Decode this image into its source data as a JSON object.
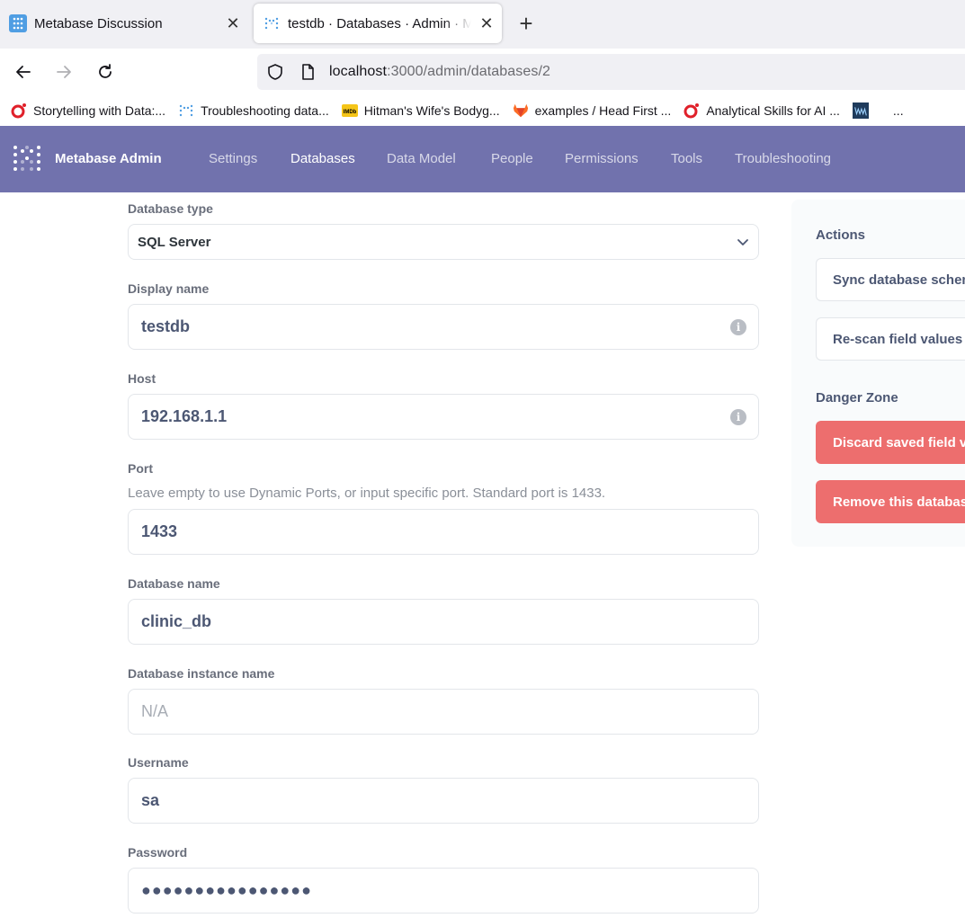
{
  "browser": {
    "tabs": [
      {
        "title": "Metabase Discussion",
        "close": "✕"
      },
      {
        "title": "testdb · Databases · Admin · Metabase",
        "close": "✕"
      }
    ],
    "new_tab": "+",
    "url_host": "localhost",
    "url_path": ":3000/admin/databases/2",
    "bookmarks": [
      {
        "label": "Storytelling with Data:...",
        "icon": "opera-icon"
      },
      {
        "label": "Troubleshooting data...",
        "icon": "metabase-icon"
      },
      {
        "label": "Hitman's Wife's Bodyg...",
        "icon": "imdb-icon"
      },
      {
        "label": "examples / Head First ...",
        "icon": "gitlab-icon"
      },
      {
        "label": "Analytical Skills for AI ...",
        "icon": "opera-icon"
      },
      {
        "label": "...",
        "icon": "site-icon"
      }
    ]
  },
  "admin_nav": {
    "brand": "Metabase Admin",
    "items": [
      "Settings",
      "Databases",
      "Data Model",
      "People",
      "Permissions",
      "Tools",
      "Troubleshooting"
    ],
    "active": "Databases"
  },
  "form": {
    "db_type_label": "Database type",
    "db_type_value": "SQL Server",
    "display_name_label": "Display name",
    "display_name_value": "testdb",
    "host_label": "Host",
    "host_value": "192.168.1.1",
    "port_label": "Port",
    "port_hint": "Leave empty to use Dynamic Ports, or input specific port. Standard port is 1433.",
    "port_value": "1433",
    "db_name_label": "Database name",
    "db_name_value": "clinic_db",
    "instance_label": "Database instance name",
    "instance_placeholder": "N/A",
    "username_label": "Username",
    "username_value": "sa",
    "password_label": "Password",
    "password_value": "●●●●●●●●●●●●●●●●"
  },
  "side_panel": {
    "actions_title": "Actions",
    "sync_button": "Sync database schema now",
    "rescan_button": "Re-scan field values now",
    "danger_title": "Danger Zone",
    "discard_button": "Discard saved field values",
    "remove_button": "Remove this database"
  },
  "colors": {
    "nav_bg": "#7172ad",
    "danger": "#ed6e6e",
    "text": "#4c5773"
  }
}
